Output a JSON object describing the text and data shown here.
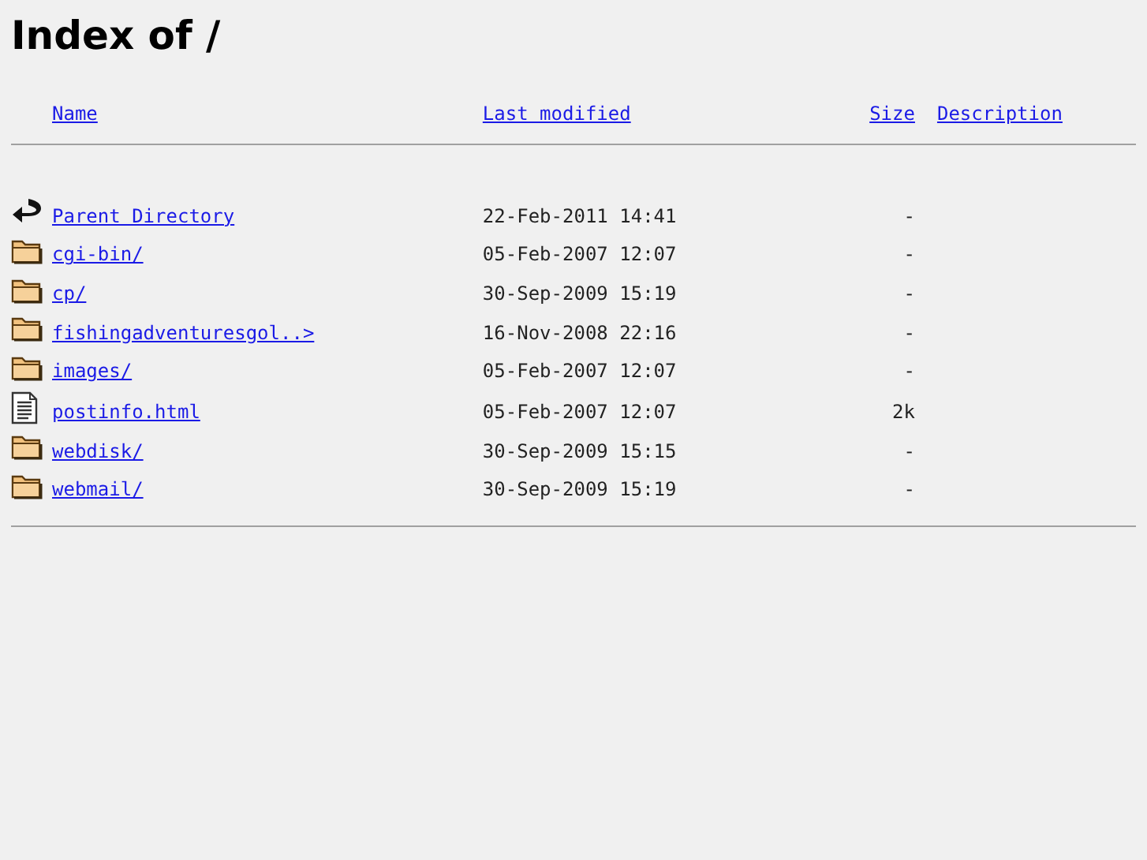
{
  "title": "Index of /",
  "columns": [
    "Name",
    "Last modified",
    "Size",
    "Description"
  ],
  "rows": [
    {
      "kind": "back",
      "name": "Parent Directory",
      "modified": "22-Feb-2011 14:41",
      "size": "-"
    },
    {
      "kind": "folder",
      "name": "cgi-bin/",
      "modified": "05-Feb-2007 12:07",
      "size": "-"
    },
    {
      "kind": "folder",
      "name": "cp/",
      "modified": "30-Sep-2009 15:19",
      "size": "-"
    },
    {
      "kind": "folder",
      "name": "fishingadventuresgol..>",
      "modified": "16-Nov-2008 22:16",
      "size": "-"
    },
    {
      "kind": "folder",
      "name": "images/",
      "modified": "05-Feb-2007 12:07",
      "size": "-"
    },
    {
      "kind": "text",
      "name": "postinfo.html",
      "modified": "05-Feb-2007 12:07",
      "size": "2k"
    },
    {
      "kind": "folder",
      "name": "webdisk/",
      "modified": "30-Sep-2009 15:15",
      "size": "-"
    },
    {
      "kind": "folder",
      "name": "webmail/",
      "modified": "30-Sep-2009 15:19",
      "size": "-"
    }
  ]
}
